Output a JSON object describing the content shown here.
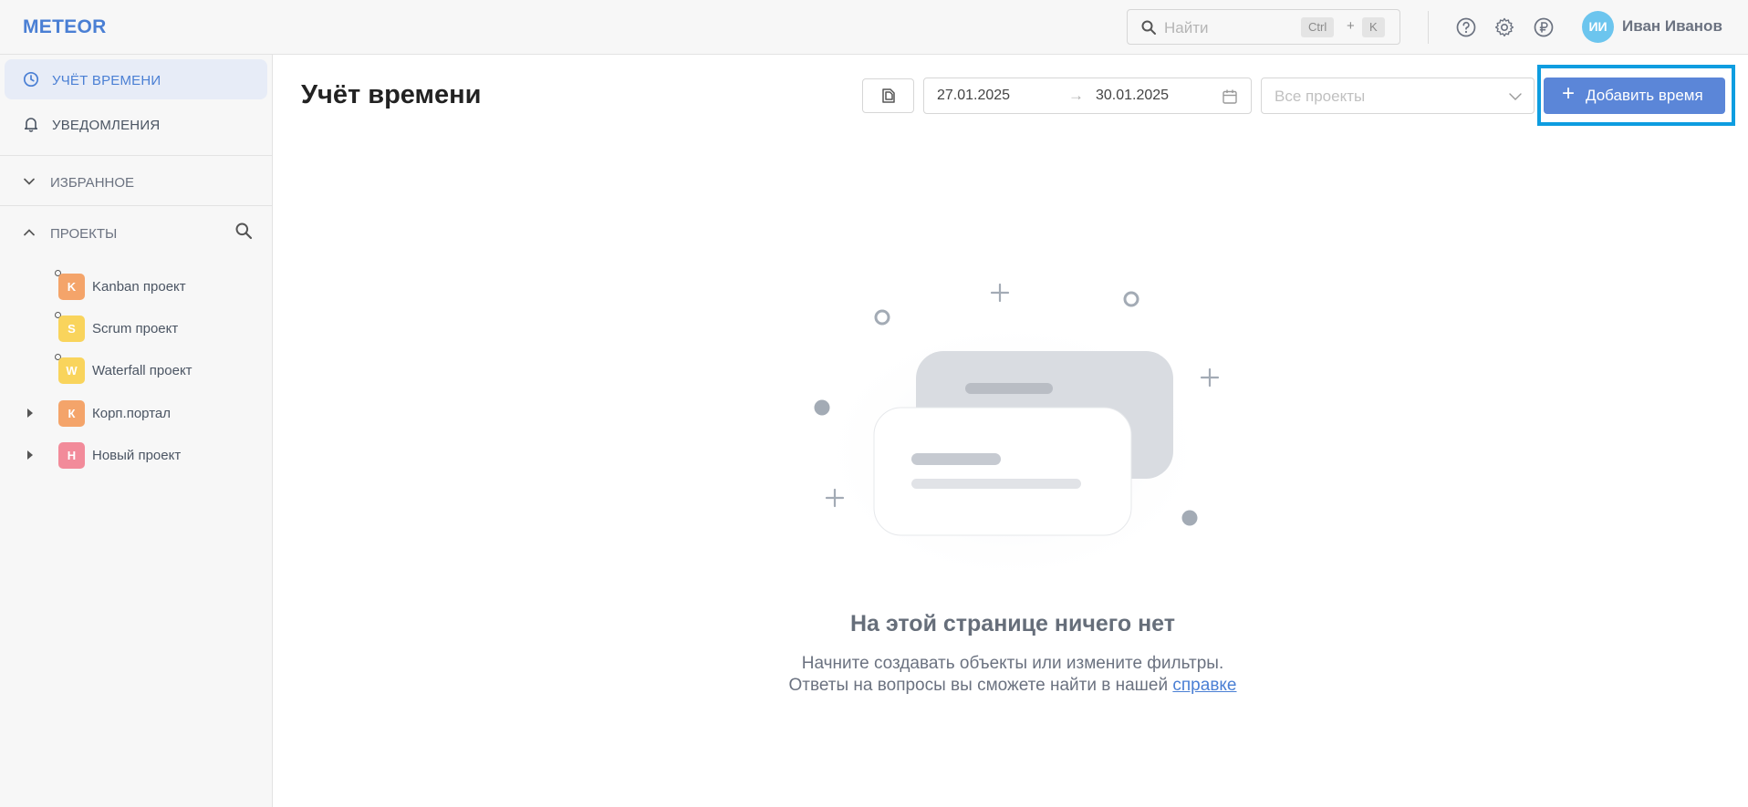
{
  "header": {
    "logo": "METEOR",
    "search": {
      "placeholder": "Найти",
      "shortcut_key1": "Ctrl",
      "shortcut_plus": "+",
      "shortcut_key2": "K"
    },
    "user": {
      "initials": "ИИ",
      "name": "Иван Иванов"
    }
  },
  "sidebar": {
    "nav": [
      {
        "label": "УЧЁТ ВРЕМЕНИ",
        "icon": "clock-icon",
        "active": true
      },
      {
        "label": "УВЕДОМЛЕНИЯ",
        "icon": "bell-icon",
        "active": false
      }
    ],
    "favorites_label": "ИЗБРАННОЕ",
    "projects_label": "ПРОЕКТЫ",
    "projects": [
      {
        "badge": "K",
        "label": "Kanban проект",
        "color": "#f4a46a"
      },
      {
        "badge": "S",
        "label": "Scrum проект",
        "color": "#f9d45c"
      },
      {
        "badge": "W",
        "label": "Waterfall проект",
        "color": "#f9d45c"
      },
      {
        "badge": "К",
        "label": "Корп.портал",
        "color": "#f4a46a"
      },
      {
        "badge": "Н",
        "label": "Новый проект",
        "color": "#f28b9a"
      }
    ]
  },
  "main": {
    "title": "Учёт времени",
    "date_from": "27.01.2025",
    "date_arrow": "→",
    "date_to": "30.01.2025",
    "projects_placeholder": "Все проекты",
    "add_plus": "+",
    "add_button": "Добавить время",
    "accent_color": "#5b86d8"
  },
  "empty_state": {
    "title": "На этой странице ничего нет",
    "line1": "Начните создавать объекты или измените фильтры.",
    "line2_prefix": "Ответы на вопросы вы сможете найти в нашей",
    "line2_link": "справке"
  }
}
